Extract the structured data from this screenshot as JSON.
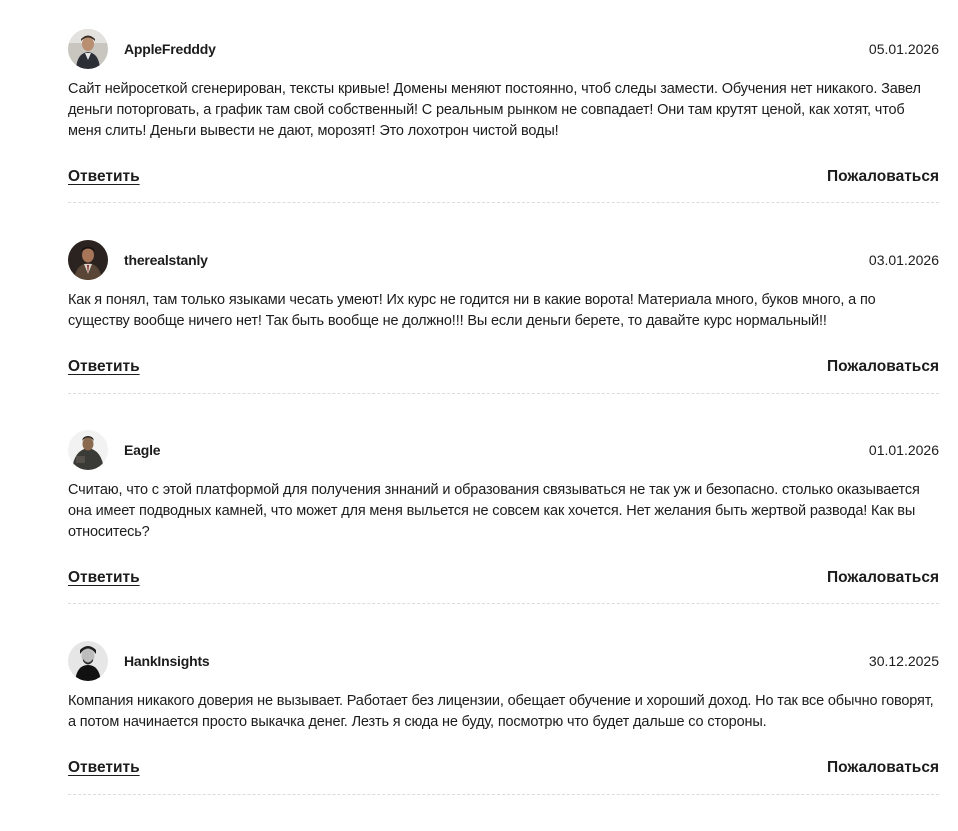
{
  "comments": [
    {
      "username": "AppleFredddy",
      "date": "05.01.2026",
      "text": "Сайт нейросеткой сгенерирован, тексты кривые! Домены меняют постоянно, чтоб следы замести. Обучения нет никакого. Завел деньги поторговать, а график там свой собственный! С реальным рынком не совпадает! Они там крутят ценой, как хотят, чтоб меня слить! Деньги вывести не дают, морозят! Это лохотрон чистой воды!",
      "reply_label": "Ответить",
      "report_label": "Пожаловаться"
    },
    {
      "username": "therealstanly",
      "date": "03.01.2026",
      "text": "Как я понял, там только языками чесать умеют! Их курс не годится ни в какие ворота! Материала много, буков много, а по существу вообще ничего нет! Так быть вообще не должно!!! Вы если деньги берете, то давайте курс нормальный!!",
      "reply_label": "Ответить",
      "report_label": "Пожаловаться"
    },
    {
      "username": "Eagle",
      "date": "01.01.2026",
      "text": "Считаю, что с этой платформой для получения зннаний и образования связываться не так уж и безопасно. столько оказывается она имеет подводных камней, что может для меня выльется не совсем как хочется. Нет желания быть жертвой развода! Как вы относитесь?",
      "reply_label": "Ответить",
      "report_label": "Пожаловаться"
    },
    {
      "username": "HankInsights",
      "date": "30.12.2025",
      "text": "Компания никакого доверия не вызывает. Работает без лицензии, обещает обучение и хороший доход. Но так все обычно говорят, а потом начинается просто выкачка денег. Лезть я сюда не буду, посмотрю что будет дальше со стороны.",
      "reply_label": "Ответить",
      "report_label": "Пожаловаться"
    }
  ]
}
